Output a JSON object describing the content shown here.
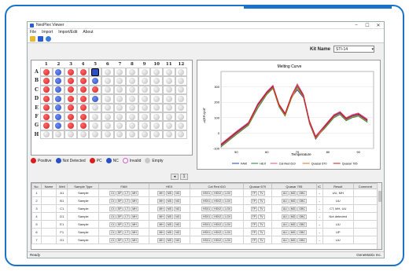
{
  "window": {
    "title": "NeoPlex Viewer",
    "controls": [
      "–",
      "☐",
      "✕"
    ]
  },
  "menu": [
    "File",
    "Import",
    "Import/Edit",
    "About"
  ],
  "toolbar": {
    "icons": [
      "open-icon",
      "save-icon",
      "help-icon"
    ]
  },
  "kit": {
    "label": "Kit Name",
    "value": "STI-14"
  },
  "plate": {
    "columns": [
      "1",
      "2",
      "3",
      "4",
      "5",
      "6",
      "7",
      "8",
      "9",
      "10",
      "11",
      "12"
    ],
    "rows": [
      "A",
      "B",
      "C",
      "D",
      "E",
      "F",
      "G",
      "H"
    ],
    "wells": [
      [
        "P",
        "N",
        "P",
        "P",
        "S",
        "E",
        "E",
        "E",
        "E",
        "E",
        "E",
        "E"
      ],
      [
        "P",
        "N",
        "P",
        "P",
        "N",
        "E",
        "E",
        "E",
        "E",
        "E",
        "E",
        "E"
      ],
      [
        "P",
        "N",
        "P",
        "P",
        "P",
        "E",
        "E",
        "E",
        "E",
        "E",
        "E",
        "E"
      ],
      [
        "P",
        "N",
        "P",
        "P",
        "N",
        "E",
        "E",
        "E",
        "E",
        "E",
        "E",
        "E"
      ],
      [
        "P",
        "N",
        "P",
        "P",
        "E",
        "E",
        "E",
        "E",
        "E",
        "E",
        "E",
        "E"
      ],
      [
        "P",
        "N",
        "P",
        "P",
        "E",
        "E",
        "E",
        "E",
        "E",
        "E",
        "E",
        "E"
      ],
      [
        "P",
        "N",
        "P",
        "P",
        "E",
        "E",
        "E",
        "E",
        "E",
        "E",
        "E",
        "E"
      ],
      [
        "E",
        "E",
        "E",
        "E",
        "E",
        "E",
        "E",
        "E",
        "E",
        "E",
        "E",
        "E"
      ]
    ]
  },
  "legend": [
    {
      "label": "Positive",
      "color": "#d81e1e"
    },
    {
      "label": "Not Detected",
      "color": "#2b4fc4"
    },
    {
      "label": "PC",
      "color": "#d81e1e"
    },
    {
      "label": "NC",
      "color": "#2b4fc4"
    },
    {
      "label": "Invalid",
      "color": "#d05ad0"
    },
    {
      "label": "Empty",
      "color": "#c8c8c8"
    }
  ],
  "chart_data": {
    "type": "line",
    "title": "Melting Curve",
    "xlabel": "Temperature",
    "ylabel": "-d(RFU)/dT",
    "xlim": [
      45,
      95
    ],
    "ylim": [
      -100,
      400
    ],
    "xticks": [
      50,
      60,
      70,
      80,
      90
    ],
    "yticks": [
      -100,
      0,
      100,
      200,
      300
    ],
    "series": [
      {
        "name": "FAM",
        "color": "#1f3fbf",
        "points": [
          [
            45,
            -80
          ],
          [
            50,
            0
          ],
          [
            54,
            60
          ],
          [
            57,
            180
          ],
          [
            60,
            260
          ],
          [
            62,
            300
          ],
          [
            64,
            180
          ],
          [
            66,
            120
          ],
          [
            68,
            230
          ],
          [
            70,
            280
          ],
          [
            72,
            230
          ],
          [
            74,
            60
          ],
          [
            76,
            -40
          ],
          [
            79,
            40
          ],
          [
            82,
            110
          ],
          [
            84,
            130
          ],
          [
            86,
            90
          ],
          [
            88,
            110
          ],
          [
            90,
            120
          ],
          [
            93,
            80
          ]
        ]
      },
      {
        "name": "HEX",
        "color": "#1e8a3a",
        "points": [
          [
            45,
            -90
          ],
          [
            50,
            -10
          ],
          [
            54,
            50
          ],
          [
            57,
            160
          ],
          [
            60,
            250
          ],
          [
            62,
            290
          ],
          [
            64,
            170
          ],
          [
            66,
            110
          ],
          [
            68,
            220
          ],
          [
            70,
            300
          ],
          [
            72,
            240
          ],
          [
            74,
            70
          ],
          [
            76,
            -30
          ],
          [
            79,
            30
          ],
          [
            82,
            100
          ],
          [
            84,
            120
          ],
          [
            86,
            80
          ],
          [
            88,
            100
          ],
          [
            90,
            110
          ],
          [
            93,
            70
          ]
        ]
      },
      {
        "name": "Cal Red 610",
        "color": "#e04a9a",
        "points": [
          [
            45,
            -70
          ],
          [
            50,
            10
          ],
          [
            54,
            70
          ],
          [
            57,
            190
          ],
          [
            60,
            270
          ],
          [
            62,
            310
          ],
          [
            64,
            190
          ],
          [
            66,
            130
          ],
          [
            68,
            240
          ],
          [
            70,
            320
          ],
          [
            72,
            250
          ],
          [
            74,
            80
          ],
          [
            76,
            -20
          ],
          [
            79,
            50
          ],
          [
            82,
            120
          ],
          [
            84,
            140
          ],
          [
            86,
            100
          ],
          [
            88,
            120
          ],
          [
            90,
            130
          ],
          [
            93,
            90
          ]
        ]
      },
      {
        "name": "Quasar 670",
        "color": "#e07020",
        "points": [
          [
            45,
            -85
          ],
          [
            50,
            -5
          ],
          [
            54,
            55
          ],
          [
            57,
            170
          ],
          [
            60,
            255
          ],
          [
            62,
            295
          ],
          [
            64,
            175
          ],
          [
            66,
            115
          ],
          [
            68,
            225
          ],
          [
            70,
            290
          ],
          [
            72,
            235
          ],
          [
            74,
            65
          ],
          [
            76,
            -35
          ],
          [
            79,
            35
          ],
          [
            82,
            105
          ],
          [
            84,
            125
          ],
          [
            86,
            85
          ],
          [
            88,
            105
          ],
          [
            90,
            115
          ],
          [
            93,
            75
          ]
        ]
      },
      {
        "name": "Quasar 705",
        "color": "#c41818",
        "points": [
          [
            45,
            -75
          ],
          [
            50,
            5
          ],
          [
            54,
            65
          ],
          [
            57,
            185
          ],
          [
            60,
            265
          ],
          [
            62,
            305
          ],
          [
            64,
            185
          ],
          [
            66,
            125
          ],
          [
            68,
            235
          ],
          [
            70,
            310
          ],
          [
            72,
            245
          ],
          [
            74,
            75
          ],
          [
            76,
            -25
          ],
          [
            79,
            45
          ],
          [
            82,
            115
          ],
          [
            84,
            135
          ],
          [
            86,
            95
          ],
          [
            88,
            115
          ],
          [
            90,
            125
          ],
          [
            93,
            85
          ]
        ]
      }
    ]
  },
  "pager": {
    "first": "◂",
    "page": "1"
  },
  "table": {
    "headers": [
      "No.",
      "Name",
      "Well",
      "Sample Type",
      "FAM",
      "HEX",
      "Cal Red 610",
      "Quasar 670",
      "Quasar 705",
      "IC",
      "Result",
      "Comment"
    ],
    "fam_sub": [
      "Ct",
      "SP",
      "LT",
      "MH"
    ],
    "hex_sub": [
      "MH",
      "MS",
      "NG"
    ],
    "cal_sub": [
      "HSV1",
      "HSV2",
      "LGV"
    ],
    "q670_sub": [
      "TP",
      "TV"
    ],
    "q705_sub": [
      "UU",
      "MG",
      "GBC"
    ],
    "rows": [
      {
        "no": "1",
        "name": "",
        "well": "A1",
        "type": "Sample",
        "result": "UU, MH",
        "mark": "-"
      },
      {
        "no": "2",
        "name": "",
        "well": "B1",
        "type": "Sample",
        "result": "UU",
        "mark": "-"
      },
      {
        "no": "3",
        "name": "",
        "well": "C1",
        "type": "Sample",
        "result": "CT, MH, UU",
        "mark": "-"
      },
      {
        "no": "4",
        "name": "",
        "well": "D1",
        "type": "Sample",
        "result": "Not detected",
        "mark": "-"
      },
      {
        "no": "5",
        "name": "",
        "well": "E1",
        "type": "Sample",
        "result": "UU",
        "mark": "-"
      },
      {
        "no": "6",
        "name": "",
        "well": "F1",
        "type": "Sample",
        "result": "UP",
        "mark": "-"
      },
      {
        "no": "7",
        "name": "",
        "well": "G1",
        "type": "Sample",
        "result": "UU",
        "mark": "-"
      }
    ]
  },
  "status": {
    "left": "Ready",
    "right": "GeneMatrix Inc."
  }
}
